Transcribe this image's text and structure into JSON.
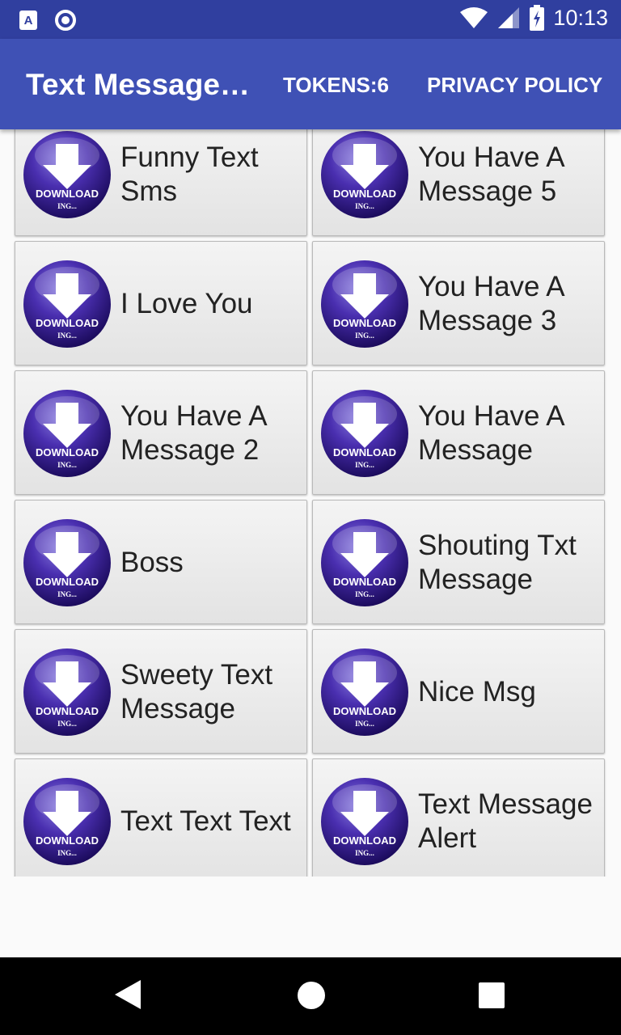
{
  "status_bar": {
    "time": "10:13",
    "left_icon_letter": "A",
    "icons": [
      "text-a-icon",
      "circle-icon",
      "wifi-icon",
      "signal-icon",
      "battery-icon"
    ]
  },
  "app_bar": {
    "title": "Text Message…",
    "tokens_label": "TOKENS:6",
    "privacy_label": "PRIVACY POLICY",
    "color": "#3f51b5",
    "status_color": "#303f9f"
  },
  "download_icon": {
    "text_main": "DOWNLOAD",
    "text_sub": "ING..."
  },
  "tiles": [
    {
      "label": "Funny Text Sms"
    },
    {
      "label": "You Have A Message 5"
    },
    {
      "label": "I Love You"
    },
    {
      "label": "You Have A Message 3"
    },
    {
      "label": "You Have A Message 2"
    },
    {
      "label": "You Have A Message"
    },
    {
      "label": "Boss"
    },
    {
      "label": "Shouting Txt Message"
    },
    {
      "label": "Sweety Text Message"
    },
    {
      "label": "Nice Msg"
    },
    {
      "label": "Text Text Text"
    },
    {
      "label": "Text Message Alert"
    }
  ],
  "nav_bar": {
    "icons": [
      "back-icon",
      "home-icon",
      "recents-icon"
    ]
  }
}
